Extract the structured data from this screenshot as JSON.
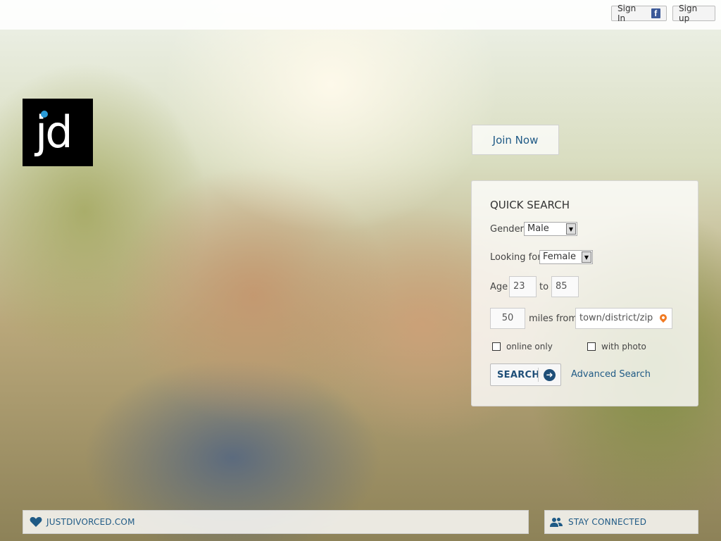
{
  "header": {
    "sign_in_label": "Sign In",
    "facebook_icon_glyph": "f",
    "sign_up_label": "Sign up"
  },
  "logo": {
    "text": "jd"
  },
  "join": {
    "label": "Join Now"
  },
  "quick_search": {
    "title": "QUICK SEARCH",
    "gender_label": "Gender",
    "gender_value": "Male",
    "looking_for_label": "Looking for",
    "looking_for_value": "Female",
    "age_label": "Age",
    "age_from": "23",
    "age_to_label": "to",
    "age_to": "85",
    "miles_value": "50",
    "miles_from_label": "miles from",
    "location_placeholder": "town/district/zip",
    "online_only_label": "online only",
    "with_photo_label": "with photo",
    "search_label": "SEARCH",
    "advanced_search_label": "Advanced Search"
  },
  "footer": {
    "site_label": "JUSTDIVORCED.COM",
    "stay_connected_label": "STAY CONNECTED"
  },
  "colors": {
    "accent": "#1f5a85",
    "logo_dot": "#2a9bd7",
    "facebook": "#3b5998",
    "pin": "#f07a23"
  }
}
